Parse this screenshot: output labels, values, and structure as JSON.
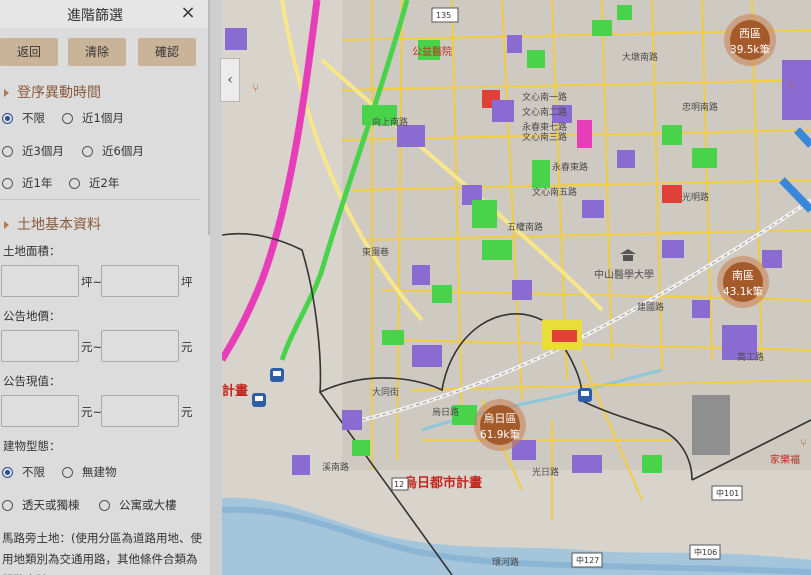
{
  "panel": {
    "title": "進階篩選",
    "close_icon": "×",
    "buttons": {
      "back": "返回",
      "clear": "清除",
      "confirm": "確認"
    },
    "registration_section": {
      "title": "登序異動時間",
      "options": [
        "不限",
        "近1個月",
        "近3個月",
        "近6個月",
        "近1年",
        "近2年"
      ],
      "selected": "不限"
    },
    "land_section": {
      "title": "土地基本資料",
      "area_label": "土地面積：",
      "area_unit": "坪",
      "range_sep": "~",
      "price_label": "公告地價：",
      "price_unit": "元",
      "present_label": "公告現值：",
      "present_unit": "元",
      "building_label": "建物型態：",
      "building_options": [
        "不限",
        "無建物",
        "透天或獨棟",
        "公寓或大樓"
      ],
      "building_selected": "不限"
    },
    "note": "馬路旁土地：(使用分區為道路用地、使用地類別為交通用路，其他條件合類為服務土地)"
  },
  "map": {
    "clusters": [
      {
        "name": "西區",
        "count": "39.5k筆"
      },
      {
        "name": "南區",
        "count": "43.1k筆"
      },
      {
        "name": "烏日區",
        "count": "61.9k筆"
      }
    ],
    "labels": {
      "station": "中山醫學大學",
      "plan": "烏日都市計畫",
      "plan2": "計畫",
      "market": "家樂福",
      "hospital": "公益醫院"
    },
    "road_labels": [
      "文心南一路",
      "文心南三路",
      "五權南路",
      "永春東七路",
      "永春東路",
      "向上南路",
      "大墩南路",
      "忠明南路",
      "文心南五路",
      "建國路",
      "高工路",
      "光明路",
      "環河路",
      "大同街",
      "東園巷",
      "烏日路",
      "光日路",
      "溪南路",
      "文心南二路"
    ],
    "shields": [
      "135",
      "中101",
      "中106",
      "中127",
      "12"
    ],
    "colors": {
      "cluster": "#a45a2a",
      "ring": "#c9835a",
      "road": "#f3cd3a",
      "green": "#48d34a",
      "pink": "#e73db9",
      "purple": "#8a6bd1",
      "blue": "#3a86d8",
      "red": "#e04038"
    }
  }
}
